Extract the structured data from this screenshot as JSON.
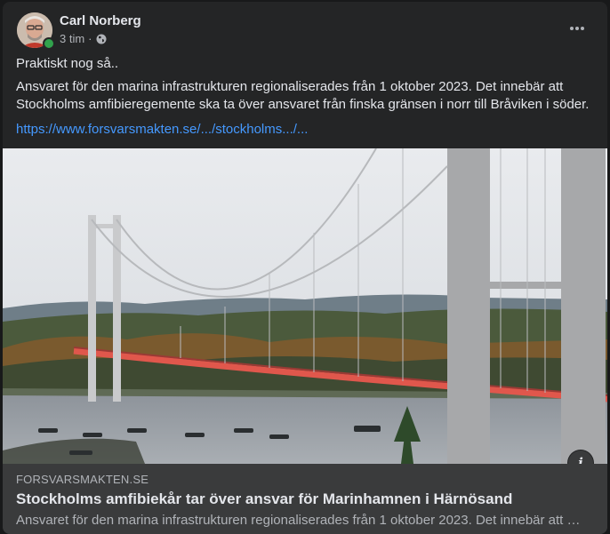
{
  "post": {
    "author": "Carl Norberg",
    "time": "3 tim",
    "separator": "·",
    "audience_icon": "globe-icon",
    "more_icon": "more-horizontal-icon",
    "text_line1": "Praktiskt nog så..",
    "text_paragraph": "Ansvaret för den marina infrastrukturen regionaliserades från 1 oktober 2023. Det innebär att Stockholms amfibieregemente ska ta över ansvaret från finska gränsen i norr till Bråviken i söder.",
    "link_text": "https://www.forsvarsmakten.se/.../stockholms.../..."
  },
  "link_preview": {
    "domain": "FORSVARSMAKTEN.SE",
    "title": "Stockholms amfibiekår tar över ansvar för Marinhamnen i Härnösand",
    "description": "Ansvaret för den marina infrastrukturen regionaliserades från 1 oktober 2023. Det innebär att …",
    "info_label": "i"
  },
  "colors": {
    "card_bg": "#242526",
    "link_blue": "#4599ff",
    "online_green": "#31a24c",
    "preview_bg": "#3a3b3c"
  }
}
